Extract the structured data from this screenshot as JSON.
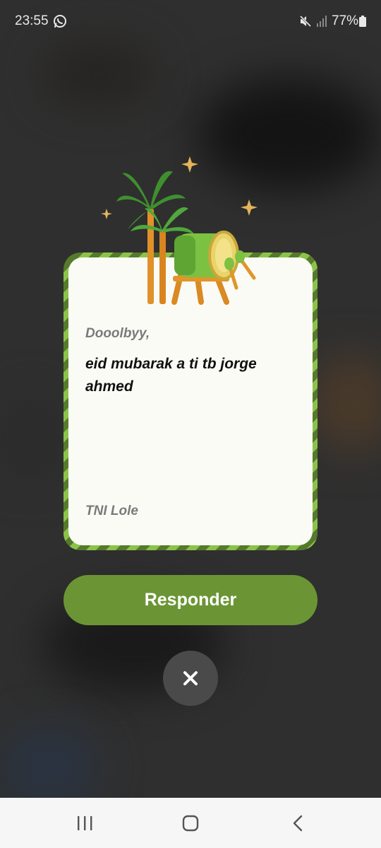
{
  "status_bar": {
    "time": "23:55",
    "battery": "77%",
    "icons": [
      "whatsapp-icon",
      "mute-icon",
      "signal-icon",
      "battery-icon"
    ]
  },
  "card": {
    "greeting": "Dooolbyy,",
    "message": "eid mubarak a ti tb jorge ahmed",
    "signature": "TNI Lole",
    "illustration": "palm-trees-drum-stars",
    "frame_colors": [
      "#8bc34a",
      "#557a2c"
    ]
  },
  "actions": {
    "reply_label": "Responder",
    "close_icon": "close-icon"
  },
  "nav_bar": {
    "items": [
      "recents-icon",
      "home-icon",
      "back-icon"
    ]
  },
  "colors": {
    "accent": "#6b9535",
    "overlay": "#2f2f2f"
  }
}
